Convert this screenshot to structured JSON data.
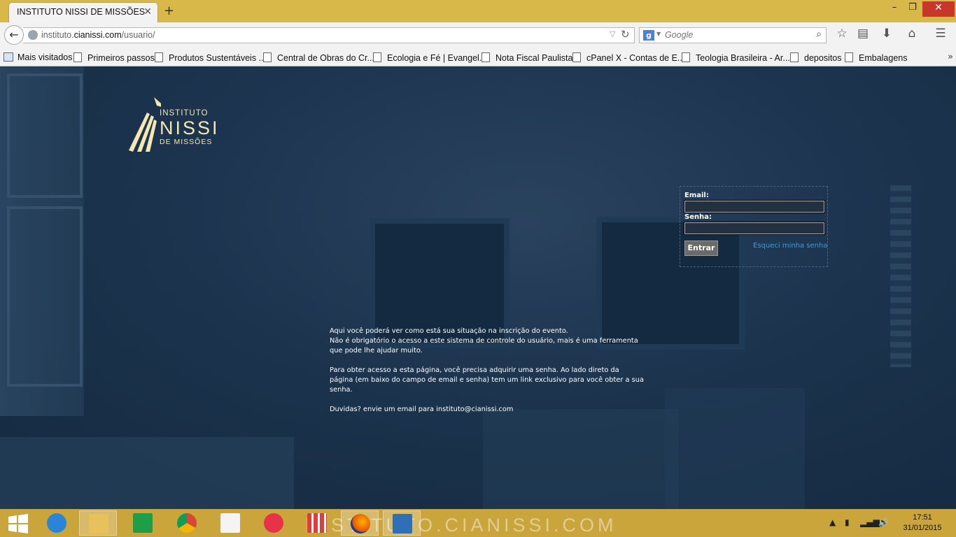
{
  "browser": {
    "tab_title": "INSTITUTO NISSI DE MISSÕES",
    "url_prefix": "instituto.",
    "url_host": "cianissi.com",
    "url_path": "/usuario/",
    "search_placeholder": "Google",
    "window_controls": {
      "minimize": "–",
      "maximize": "❐",
      "close": "✕"
    },
    "bookmarks": [
      "Mais visitados",
      "Primeiros passos",
      "Produtos Sustentáveis ...",
      "Central de Obras do Cr...",
      "Ecologia e Fé | Evangel...",
      "Nota Fiscal Paulista",
      "cPanel X - Contas de E...",
      "Teologia Brasileira - Ar...",
      "depositos",
      "Embalagens"
    ],
    "overflow_marker": "»"
  },
  "page": {
    "logo": {
      "line1": "INSTITUTO",
      "line2": "NISSI",
      "line3": "DE MISSÕES"
    },
    "login": {
      "email_label": "Email:",
      "password_label": "Senha:",
      "submit_label": "Entrar",
      "forgot_link": "Esqueci minha senha"
    },
    "info": {
      "line1": "Aqui você poderá ver como está sua situação na inscrição do evento.",
      "line2": "Não é obrigatório o acesso a este sistema de controle do usuário, mais é uma ferramenta que pode lhe ajudar muito.",
      "line3": "Para obter acesso a esta página, você precisa adquirir uma senha. Ao lado direto da página (em baixo do campo de email e senha) tem um link exclusivo para você obter a sua senha.",
      "line4": "Duvidas? envie um email para instituto@cianissi.com"
    }
  },
  "taskbar": {
    "watermark": "INSTITUTO.CIANISSI.COM",
    "apps": [
      "start-icon",
      "internet-explorer-icon",
      "file-explorer-icon",
      "store-icon",
      "chrome-icon",
      "file-icon",
      "itunes-icon",
      "apps-grid-icon",
      "firefox-icon",
      "writer-icon"
    ],
    "time": "17:51",
    "date": "31/01/2015"
  },
  "colors": {
    "titlebar": "#d9b84a",
    "taskbar": "#c9a53c",
    "page_bg": "#1b3148",
    "link": "#3a9be0",
    "logo": "#f4e8b0"
  }
}
